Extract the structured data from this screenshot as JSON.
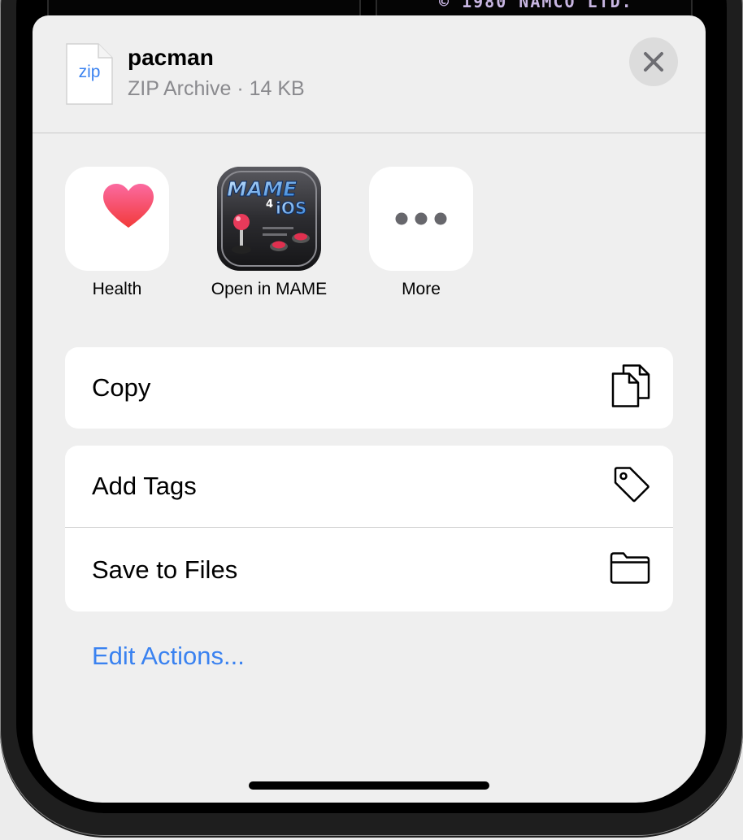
{
  "file": {
    "icon_label": "zip",
    "name": "pacman",
    "meta": "ZIP Archive · 14 KB"
  },
  "background": {
    "text": "© 1980 NAMCO LTD."
  },
  "apps": [
    {
      "label": "Health",
      "icon": "heart-icon"
    },
    {
      "label": "Open in MAME",
      "icon": "mame4ios-icon"
    },
    {
      "label": "More",
      "icon": "ellipsis-icon"
    }
  ],
  "actions": {
    "copy": {
      "label": "Copy",
      "icon": "copy-icon"
    },
    "add_tags": {
      "label": "Add Tags",
      "icon": "tag-icon"
    },
    "save_to_files": {
      "label": "Save to Files",
      "icon": "folder-icon"
    }
  },
  "edit_actions": "Edit Actions...",
  "colors": {
    "accent": "#3a82f0",
    "secondary_text": "#8a8a8e",
    "sheet_background": "#efefef"
  }
}
